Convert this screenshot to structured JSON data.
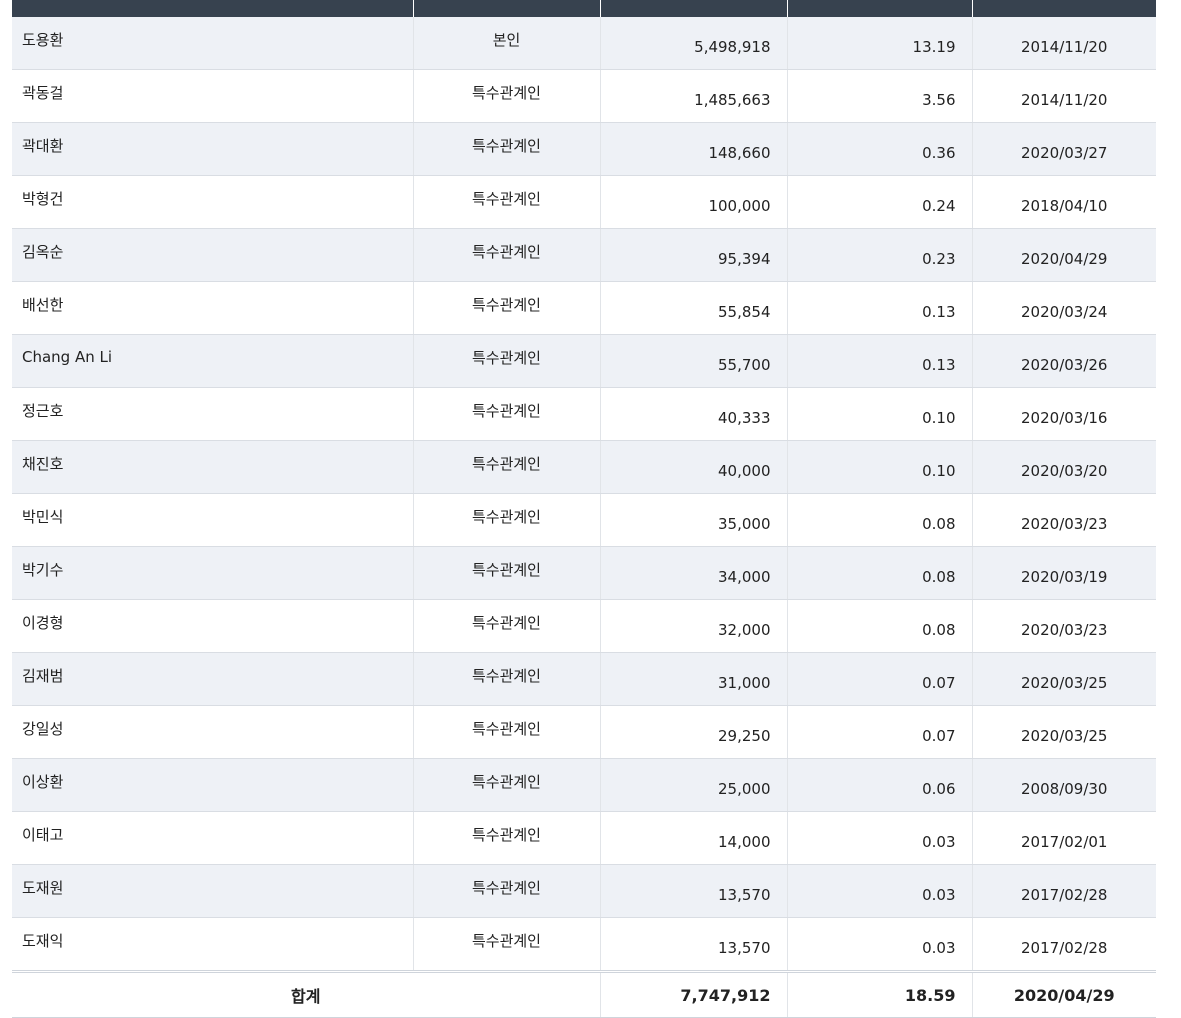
{
  "header": {
    "columns": [
      "",
      "",
      "",
      "",
      ""
    ]
  },
  "rows": [
    {
      "name": "도용환",
      "relation": "본인",
      "shares": "5,498,918",
      "ratio": "13.19",
      "date": "2014/11/20"
    },
    {
      "name": "곽동걸",
      "relation": "특수관계인",
      "shares": "1,485,663",
      "ratio": "3.56",
      "date": "2014/11/20"
    },
    {
      "name": "곽대환",
      "relation": "특수관계인",
      "shares": "148,660",
      "ratio": "0.36",
      "date": "2020/03/27"
    },
    {
      "name": "박형건",
      "relation": "특수관계인",
      "shares": "100,000",
      "ratio": "0.24",
      "date": "2018/04/10"
    },
    {
      "name": "김옥순",
      "relation": "특수관계인",
      "shares": "95,394",
      "ratio": "0.23",
      "date": "2020/04/29"
    },
    {
      "name": "배선한",
      "relation": "특수관계인",
      "shares": "55,854",
      "ratio": "0.13",
      "date": "2020/03/24"
    },
    {
      "name": "Chang An Li",
      "relation": "특수관계인",
      "shares": "55,700",
      "ratio": "0.13",
      "date": "2020/03/26"
    },
    {
      "name": "정근호",
      "relation": "특수관계인",
      "shares": "40,333",
      "ratio": "0.10",
      "date": "2020/03/16"
    },
    {
      "name": "채진호",
      "relation": "특수관계인",
      "shares": "40,000",
      "ratio": "0.10",
      "date": "2020/03/20"
    },
    {
      "name": "박민식",
      "relation": "특수관계인",
      "shares": "35,000",
      "ratio": "0.08",
      "date": "2020/03/23"
    },
    {
      "name": "박기수",
      "relation": "특수관계인",
      "shares": "34,000",
      "ratio": "0.08",
      "date": "2020/03/19"
    },
    {
      "name": "이경형",
      "relation": "특수관계인",
      "shares": "32,000",
      "ratio": "0.08",
      "date": "2020/03/23"
    },
    {
      "name": "김재범",
      "relation": "특수관계인",
      "shares": "31,000",
      "ratio": "0.07",
      "date": "2020/03/25"
    },
    {
      "name": "강일성",
      "relation": "특수관계인",
      "shares": "29,250",
      "ratio": "0.07",
      "date": "2020/03/25"
    },
    {
      "name": "이상환",
      "relation": "특수관계인",
      "shares": "25,000",
      "ratio": "0.06",
      "date": "2008/09/30"
    },
    {
      "name": "이태고",
      "relation": "특수관계인",
      "shares": "14,000",
      "ratio": "0.03",
      "date": "2017/02/01"
    },
    {
      "name": "도재원",
      "relation": "특수관계인",
      "shares": "13,570",
      "ratio": "0.03",
      "date": "2017/02/28"
    },
    {
      "name": "도재익",
      "relation": "특수관계인",
      "shares": "13,570",
      "ratio": "0.03",
      "date": "2017/02/28"
    }
  ],
  "total": {
    "label": "합계",
    "shares": "7,747,912",
    "ratio": "18.59",
    "date": "2020/04/29"
  },
  "colors": {
    "header_bg": "#37424f",
    "stripe_bg": "#eef1f6",
    "border": "#d9dde3"
  }
}
